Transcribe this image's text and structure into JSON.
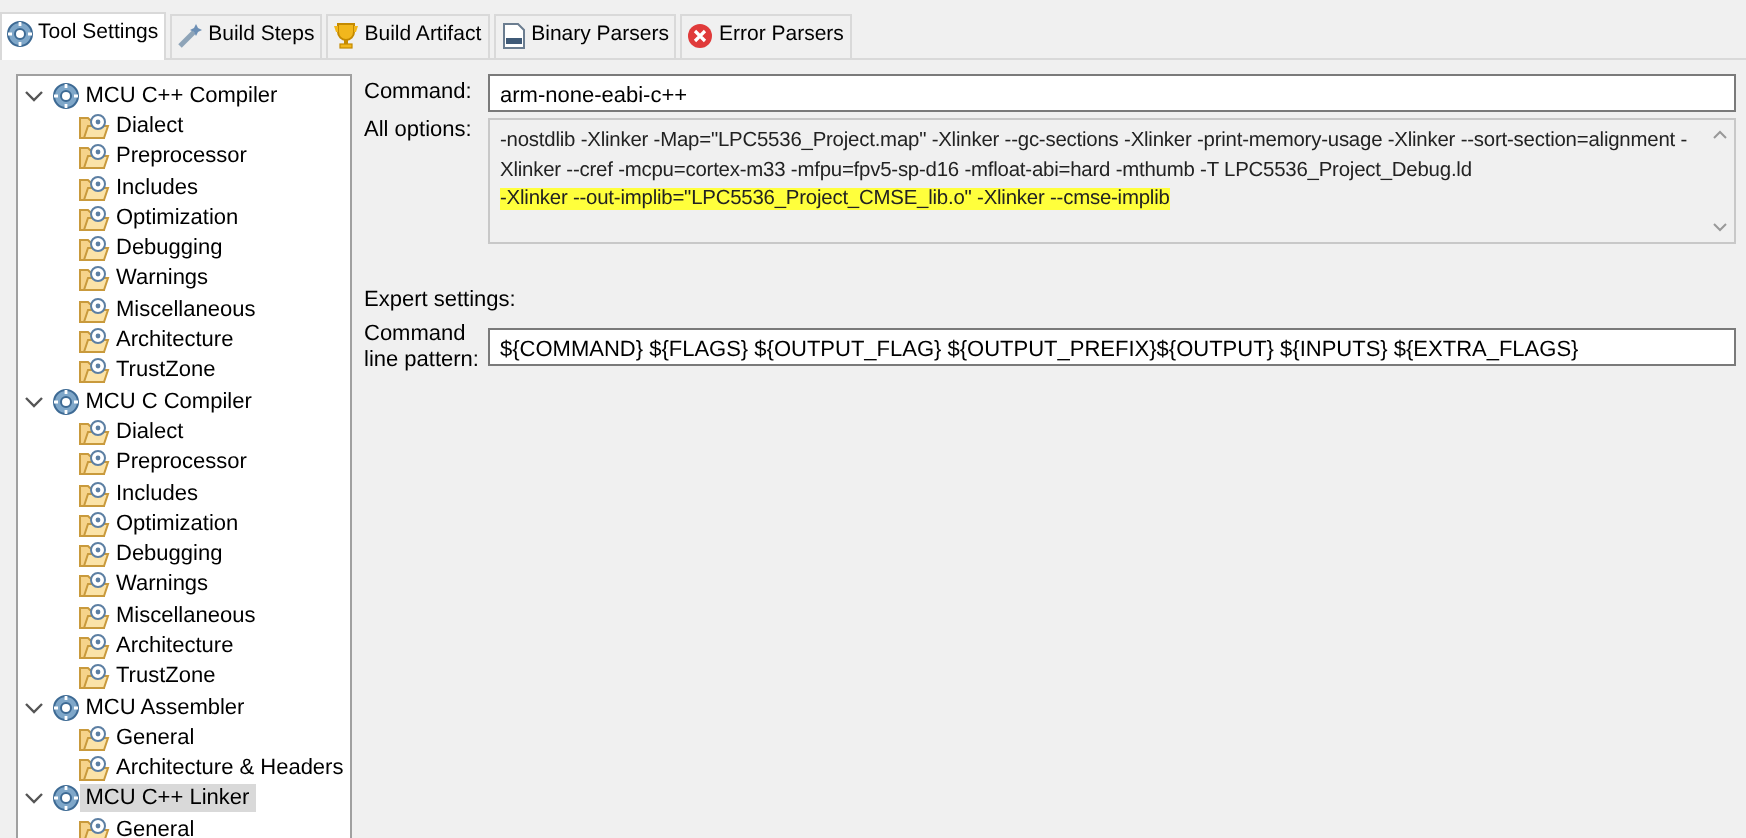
{
  "tabs": [
    {
      "label": "Tool Settings",
      "kind": "gear",
      "selected": true
    },
    {
      "label": "Build Steps",
      "kind": "wand",
      "selected": false
    },
    {
      "label": "Build Artifact",
      "kind": "trophy",
      "selected": false
    },
    {
      "label": "Binary Parsers",
      "kind": "binary",
      "selected": false
    },
    {
      "label": "Error Parsers",
      "kind": "error",
      "selected": false
    }
  ],
  "tree": [
    {
      "label": "MCU C++ Compiler",
      "expanded": true,
      "selected": false,
      "children": [
        {
          "label": "Dialect",
          "selected": false
        },
        {
          "label": "Preprocessor",
          "selected": false
        },
        {
          "label": "Includes",
          "selected": false
        },
        {
          "label": "Optimization",
          "selected": false
        },
        {
          "label": "Debugging",
          "selected": false
        },
        {
          "label": "Warnings",
          "selected": false
        },
        {
          "label": "Miscellaneous",
          "selected": false
        },
        {
          "label": "Architecture",
          "selected": false
        },
        {
          "label": "TrustZone",
          "selected": false
        }
      ]
    },
    {
      "label": "MCU C Compiler",
      "expanded": true,
      "selected": false,
      "children": [
        {
          "label": "Dialect",
          "selected": false
        },
        {
          "label": "Preprocessor",
          "selected": false
        },
        {
          "label": "Includes",
          "selected": false
        },
        {
          "label": "Optimization",
          "selected": false
        },
        {
          "label": "Debugging",
          "selected": false
        },
        {
          "label": "Warnings",
          "selected": false
        },
        {
          "label": "Miscellaneous",
          "selected": false
        },
        {
          "label": "Architecture",
          "selected": false
        },
        {
          "label": "TrustZone",
          "selected": false
        }
      ]
    },
    {
      "label": "MCU Assembler",
      "expanded": true,
      "selected": false,
      "children": [
        {
          "label": "General",
          "selected": false
        },
        {
          "label": "Architecture & Headers",
          "selected": false
        }
      ]
    },
    {
      "label": "MCU C++ Linker",
      "expanded": true,
      "selected": true,
      "children": [
        {
          "label": "General",
          "selected": false
        }
      ]
    }
  ],
  "command": {
    "label": "Command:",
    "value": "arm-none-eabi-c++"
  },
  "all_options": {
    "label": "All options:",
    "segments": [
      {
        "text": "-nostdlib -Xlinker -Map=\"LPC5536_Project.map\" -Xlinker --gc-sections -Xlinker -print-memory-usage -Xlinker --sort-section=alignment -Xlinker --cref -mcpu=cortex-m33 -mfpu=fpv5-sp-d16 -mfloat-abi=hard -mthumb -T LPC5536_Project_Debug.ld",
        "highlighted": false
      },
      {
        "text": "-Xlinker --out-implib=\"LPC5536_Project_CMSE_lib.o\" -Xlinker --cmse-implib",
        "highlighted": true
      }
    ]
  },
  "expert_settings": {
    "heading": "Expert settings:",
    "label": "Command line pattern:",
    "value": "${COMMAND} ${FLAGS} ${OUTPUT_FLAG} ${OUTPUT_PREFIX}${OUTPUT} ${INPUTS} ${EXTRA_FLAGS}"
  }
}
